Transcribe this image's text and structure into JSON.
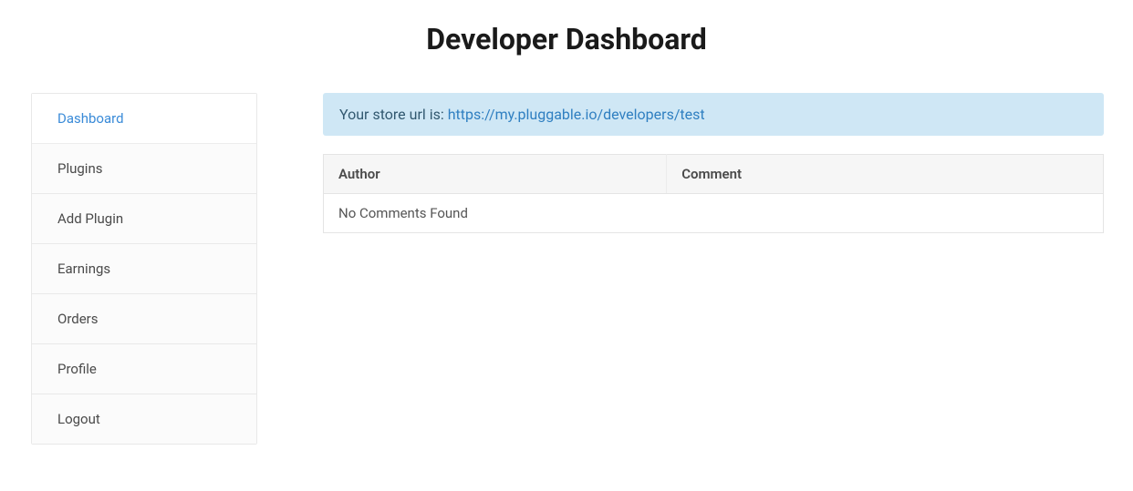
{
  "header": {
    "title": "Developer Dashboard"
  },
  "sidebar": {
    "items": [
      {
        "label": "Dashboard",
        "active": true
      },
      {
        "label": "Plugins",
        "active": false
      },
      {
        "label": "Add Plugin",
        "active": false
      },
      {
        "label": "Earnings",
        "active": false
      },
      {
        "label": "Orders",
        "active": false
      },
      {
        "label": "Profile",
        "active": false
      },
      {
        "label": "Logout",
        "active": false
      }
    ]
  },
  "alert": {
    "prefix": "Your store url is: ",
    "url": "https://my.pluggable.io/developers/test"
  },
  "table": {
    "headers": {
      "author": "Author",
      "comment": "Comment"
    },
    "empty_message": "No Comments Found"
  }
}
